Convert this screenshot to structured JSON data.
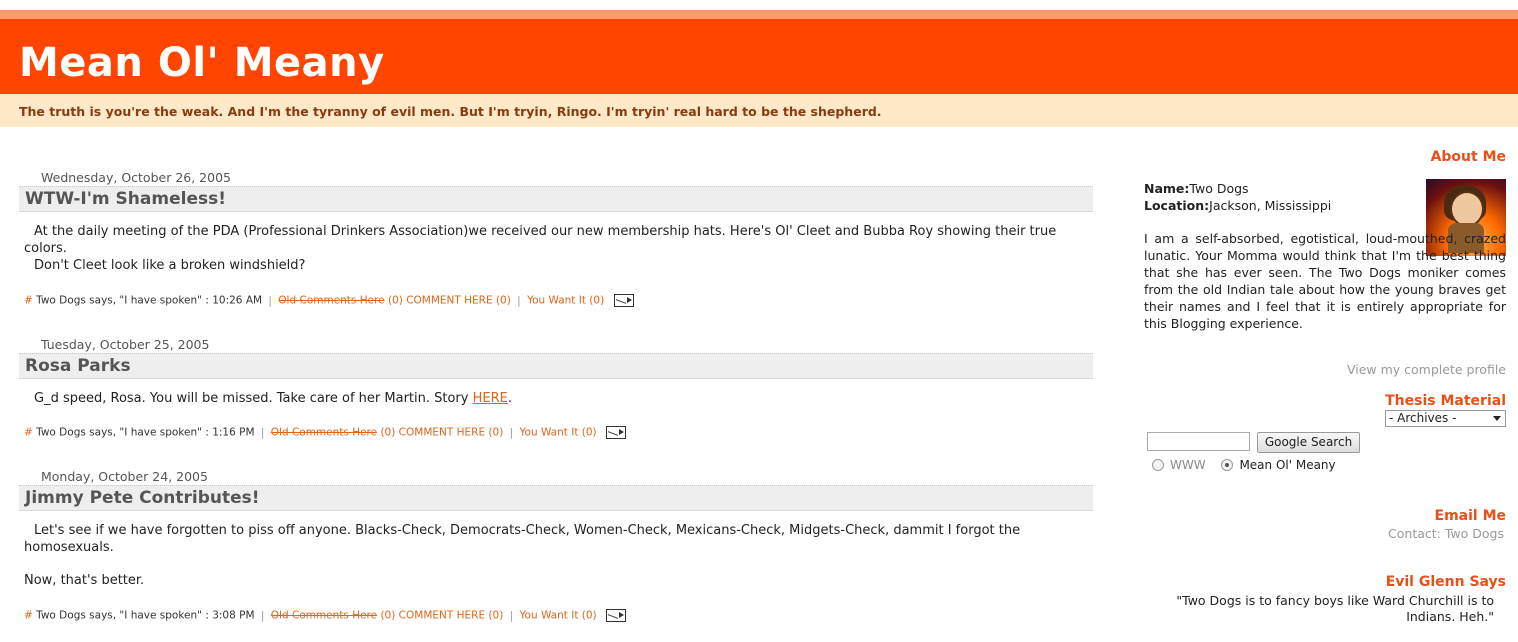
{
  "header": {
    "title": "Mean Ol' Meany",
    "description": "The truth is you're the weak. And I'm the tyranny of evil men. But I'm tryin, Ringo. I'm tryin' real hard to be the shepherd."
  },
  "posts": [
    {
      "date": "Wednesday, October 26, 2005",
      "title": "WTW-I'm Shameless!",
      "body_line1": "At the daily meeting of the PDA (Professional Drinkers Association)we received our new membership hats. Here's Ol' Cleet and Bubba Roy showing their true colors.",
      "body_line2": "Don't Cleet look like a broken windshield?",
      "footer": {
        "hash": "#",
        "author": "Two Dogs says, \"I have spoken\" : 10:26 AM",
        "old_comments": "Old Comments Here",
        "comments": "(0) COMMENT HERE (0)",
        "want_it": "You Want It (0)"
      }
    },
    {
      "date": "Tuesday, October 25, 2005",
      "title": "Rosa Parks",
      "body_text": "G_d speed, Rosa. You will be missed. Take care of her Martin. Story ",
      "body_link": "HERE",
      "body_end": ".",
      "footer": {
        "hash": "#",
        "author": "Two Dogs says, \"I have spoken\" : 1:16 PM",
        "old_comments": "Old Comments Here",
        "comments": "(0) COMMENT HERE (0)",
        "want_it": "You Want It (0)"
      }
    },
    {
      "date": "Monday, October 24, 2005",
      "title": "Jimmy Pete Contributes!",
      "body_line1": "Let's see if we have forgotten to piss off anyone. Blacks-Check, Democrats-Check, Women-Check, Mexicans-Check, Midgets-Check, dammit I forgot the homosexuals.",
      "body_line2": "Now, that's better.",
      "footer": {
        "hash": "#",
        "author": "Two Dogs says, \"I have spoken\" : 3:08 PM",
        "old_comments": "Old Comments Here",
        "comments": "(0) COMMENT HERE (0)",
        "want_it": "You Want It (0)"
      }
    }
  ],
  "sidebar": {
    "about_heading": "About Me",
    "name_label": "Name:",
    "name_value": "Two Dogs",
    "location_label": "Location:",
    "location_value": "Jackson, Mississippi",
    "about_text": "I am a self-absorbed, egotistical, loud-mouthed, crazed lunatic. Your Momma would think that I'm the best thing that she has ever seen. The Two Dogs moniker comes from the old Indian tale about how the young braves get their names and I feel that it is entirely appropriate for this Blogging experience.",
    "view_profile": "View my complete profile",
    "thesis_heading": "Thesis Material",
    "archives_selected": "- Archives -",
    "search_button": "Google Search",
    "radio_www": "WWW",
    "radio_site": "Mean Ol' Meany",
    "email_heading": "Email Me",
    "contact_label": "Contact:",
    "contact_name": "Two Dogs",
    "evil_heading": "Evil Glenn Says",
    "quote": "\"Two Dogs is to fancy boys like Ward Churchill is to Indians. Heh.\""
  },
  "colors": {
    "header_bg": "#ff4500",
    "accent": "#e8501a",
    "desc_bg": "#ffe9c8"
  }
}
